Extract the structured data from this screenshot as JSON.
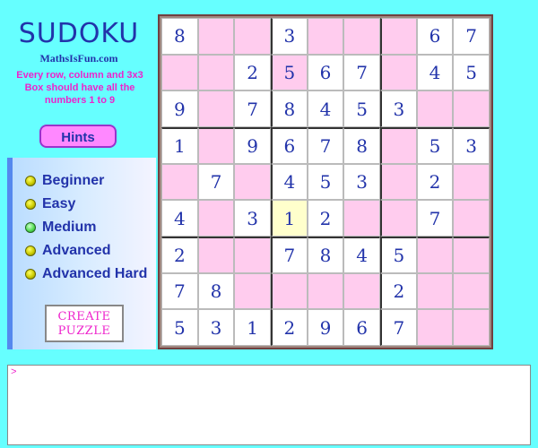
{
  "title": "SUDOKU",
  "site": "MathsIsFun.com",
  "instructions": "Every row, column and 3x3 Box should have all the numbers 1 to 9",
  "hints_label": "Hints",
  "levels": [
    {
      "label": "Beginner",
      "selected": false
    },
    {
      "label": "Easy",
      "selected": false
    },
    {
      "label": "Medium",
      "selected": true
    },
    {
      "label": "Advanced",
      "selected": false
    },
    {
      "label": "Advanced Hard",
      "selected": false
    }
  ],
  "create_puzzle": {
    "line1": "CREATE",
    "line2": "PUZZLE"
  },
  "colors": {
    "pink_cell": "#ffccee",
    "white_cell": "#ffffff",
    "highlight_cell": "#ffffcc",
    "digit": "#2233aa"
  },
  "grid": [
    [
      {
        "v": "8",
        "c": "white"
      },
      {
        "v": "",
        "c": "pink"
      },
      {
        "v": "",
        "c": "pink"
      },
      {
        "v": "3",
        "c": "white"
      },
      {
        "v": "",
        "c": "pink"
      },
      {
        "v": "",
        "c": "pink"
      },
      {
        "v": "",
        "c": "pink"
      },
      {
        "v": "6",
        "c": "white"
      },
      {
        "v": "7",
        "c": "white"
      }
    ],
    [
      {
        "v": "",
        "c": "pink"
      },
      {
        "v": "",
        "c": "pink"
      },
      {
        "v": "2",
        "c": "white"
      },
      {
        "v": "5",
        "c": "pink"
      },
      {
        "v": "6",
        "c": "white"
      },
      {
        "v": "7",
        "c": "white"
      },
      {
        "v": "",
        "c": "pink"
      },
      {
        "v": "4",
        "c": "white"
      },
      {
        "v": "5",
        "c": "white"
      }
    ],
    [
      {
        "v": "9",
        "c": "white"
      },
      {
        "v": "",
        "c": "pink"
      },
      {
        "v": "7",
        "c": "white"
      },
      {
        "v": "8",
        "c": "white"
      },
      {
        "v": "4",
        "c": "white"
      },
      {
        "v": "5",
        "c": "white"
      },
      {
        "v": "3",
        "c": "white"
      },
      {
        "v": "",
        "c": "pink"
      },
      {
        "v": "",
        "c": "pink"
      }
    ],
    [
      {
        "v": "1",
        "c": "white"
      },
      {
        "v": "",
        "c": "pink"
      },
      {
        "v": "9",
        "c": "white"
      },
      {
        "v": "6",
        "c": "white"
      },
      {
        "v": "7",
        "c": "white"
      },
      {
        "v": "8",
        "c": "white"
      },
      {
        "v": "",
        "c": "pink"
      },
      {
        "v": "5",
        "c": "white"
      },
      {
        "v": "3",
        "c": "white"
      }
    ],
    [
      {
        "v": "",
        "c": "pink"
      },
      {
        "v": "7",
        "c": "white"
      },
      {
        "v": "",
        "c": "pink"
      },
      {
        "v": "4",
        "c": "white"
      },
      {
        "v": "5",
        "c": "white"
      },
      {
        "v": "3",
        "c": "white"
      },
      {
        "v": "",
        "c": "pink"
      },
      {
        "v": "2",
        "c": "white"
      },
      {
        "v": "",
        "c": "pink"
      }
    ],
    [
      {
        "v": "4",
        "c": "white"
      },
      {
        "v": "",
        "c": "pink"
      },
      {
        "v": "3",
        "c": "white"
      },
      {
        "v": "1",
        "c": "yellow"
      },
      {
        "v": "2",
        "c": "white"
      },
      {
        "v": "",
        "c": "pink"
      },
      {
        "v": "",
        "c": "pink"
      },
      {
        "v": "7",
        "c": "white"
      },
      {
        "v": "",
        "c": "pink"
      }
    ],
    [
      {
        "v": "2",
        "c": "white"
      },
      {
        "v": "",
        "c": "pink"
      },
      {
        "v": "",
        "c": "pink"
      },
      {
        "v": "7",
        "c": "white"
      },
      {
        "v": "8",
        "c": "white"
      },
      {
        "v": "4",
        "c": "white"
      },
      {
        "v": "5",
        "c": "white"
      },
      {
        "v": "",
        "c": "pink"
      },
      {
        "v": "",
        "c": "pink"
      }
    ],
    [
      {
        "v": "7",
        "c": "white"
      },
      {
        "v": "8",
        "c": "white"
      },
      {
        "v": "",
        "c": "pink"
      },
      {
        "v": "",
        "c": "pink"
      },
      {
        "v": "",
        "c": "pink"
      },
      {
        "v": "",
        "c": "pink"
      },
      {
        "v": "2",
        "c": "white"
      },
      {
        "v": "",
        "c": "pink"
      },
      {
        "v": "",
        "c": "pink"
      }
    ],
    [
      {
        "v": "5",
        "c": "white"
      },
      {
        "v": "3",
        "c": "white"
      },
      {
        "v": "1",
        "c": "white"
      },
      {
        "v": "2",
        "c": "white"
      },
      {
        "v": "9",
        "c": "white"
      },
      {
        "v": "6",
        "c": "white"
      },
      {
        "v": "7",
        "c": "white"
      },
      {
        "v": "",
        "c": "pink"
      },
      {
        "v": "",
        "c": "pink"
      }
    ]
  ],
  "console_prompt": ">"
}
